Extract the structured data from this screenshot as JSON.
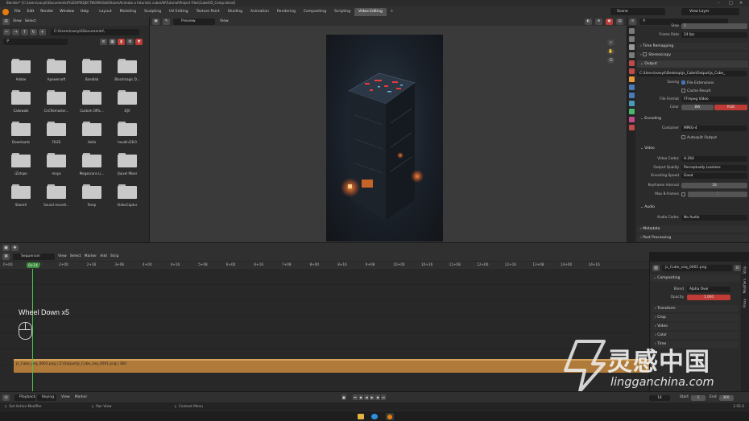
{
  "window": {
    "title": "Blender* [C:\\Users\\nanyli\\Documents\\FILES\\PROJECTWORK\\SkillShare\\Animate a futuristic cube\\All\\Tutorial\\Project Files\\Cube\\05_Comp.blend]"
  },
  "menu": [
    "File",
    "Edit",
    "Render",
    "Window",
    "Help"
  ],
  "workspaces": [
    "Layout",
    "Modeling",
    "Sculpting",
    "UV Editing",
    "Texture Paint",
    "Shading",
    "Animation",
    "Rendering",
    "Compositing",
    "Scripting",
    "Video Editing"
  ],
  "active_workspace": "Video Editing",
  "scene": {
    "label": "Scene",
    "view_layer": "View Layer"
  },
  "file_browser": {
    "header_menu": [
      "View",
      "Select"
    ],
    "path": "C:\\Users\\nanyli\\Documents\\",
    "folders": [
      "Adobe",
      "Apowersoft",
      "Bandlab",
      "Blackmagic D...",
      "Cakewalk",
      "CnCRemaster...",
      "Custom Offic...",
      "DJV",
      "Downloads",
      "FILES",
      "Hello",
      "houdini18.0",
      "iZotope",
      "maya",
      "Megascans Li...",
      "Quixel Mixer",
      "ShareX",
      "Sound recordi...",
      "Temp",
      "VideoCaptur"
    ]
  },
  "preview": {
    "mode": "Preview",
    "menu": "View"
  },
  "properties": {
    "step_label": "Step",
    "step_value": "1",
    "frame_rate_label": "Frame Rate",
    "frame_rate_value": "24 fps",
    "time_remapping": "Time Remapping",
    "stereoscopy": "Stereoscopy",
    "output": "Output",
    "output_path": "C:\\Users\\nanyli\\Desktop\\js_Cube\\Output\\js_Cube_",
    "saving_label": "Saving",
    "file_extensions": "File Extensions",
    "cache_result": "Cache Result",
    "file_format_label": "File Format",
    "file_format_value": "FFmpeg Video",
    "color_label": "Color",
    "color_bw": "BW",
    "color_rgb": "RGB",
    "encoding": "Encoding",
    "container_label": "Container",
    "container_value": "MPEG-4",
    "autosplit": "Autosplit Output",
    "video": "Video",
    "video_codec_label": "Video Codec",
    "video_codec_value": "H.264",
    "output_quality_label": "Output Quality",
    "output_quality_value": "Perceptually Lossless",
    "encoding_speed_label": "Encoding Speed",
    "encoding_speed_value": "Good",
    "keyframe_label": "Keyframe Interval",
    "keyframe_value": "18",
    "max_b_label": "Max B-frames",
    "max_b_value": "2",
    "audio": "Audio",
    "audio_codec_label": "Audio Codec",
    "audio_codec_value": "No Audio",
    "metadata": "Metadata",
    "post_processing": "Post Processing"
  },
  "sequencer": {
    "mode": "Sequencer",
    "menu": [
      "View",
      "Select",
      "Marker",
      "Add",
      "Strip"
    ],
    "ticks": [
      "0+00",
      "1+08",
      "2+00",
      "2+16",
      "3+08",
      "4+00",
      "4+16",
      "5+08",
      "6+00",
      "6+16",
      "7+08",
      "8+00",
      "8+16",
      "9+08",
      "10+00",
      "10+16",
      "11+08",
      "12+00",
      "12+16",
      "13+08",
      "14+00",
      "14+16"
    ],
    "playhead": "0+14",
    "overlay_text": "Wheel Down x5",
    "strip_label": "js_Cube_seq_0001.png | Z:\\Output\\js_Cube_seq_0001.png | 360"
  },
  "strip_panel": {
    "name": "js_Cube_seq_0001.png",
    "compositing": "Compositing",
    "blend_label": "Blend",
    "blend_value": "Alpha Over",
    "opacity_label": "Opacity",
    "opacity_value": "1.000",
    "sections": [
      "Transform",
      "Crop",
      "Video",
      "Color",
      "Time"
    ],
    "tabs": [
      "Strip",
      "Modifiers",
      "Proxy"
    ]
  },
  "timeline": {
    "menu": [
      "Playback",
      "Keying",
      "View",
      "Marker"
    ],
    "current_frame": "14",
    "start_label": "Start",
    "start_value": "1",
    "end_label": "End",
    "end_value": "360"
  },
  "status": {
    "left": "Set Active Modifier",
    "mid": "Pan View",
    "right": "Context Menu",
    "version": "2.92.0"
  },
  "watermark": {
    "cn": "灵感中国",
    "en": "lingganchina.com"
  },
  "colors": {
    "accent": "#4772b3",
    "strip": "#b07b3a",
    "playhead": "#4ec24e",
    "opacity_field": "#c03b36"
  }
}
